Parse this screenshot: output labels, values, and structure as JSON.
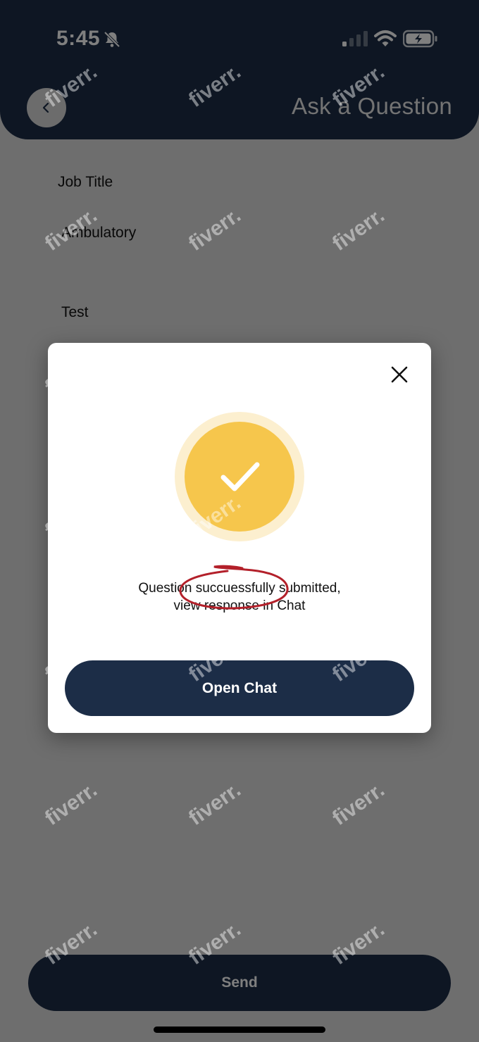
{
  "status_bar": {
    "time": "5:45",
    "icons": [
      "bell-slash-icon",
      "signal-icon",
      "wifi-icon",
      "battery-icon"
    ]
  },
  "header": {
    "title": "Ask a Question",
    "back_icon": "chevron-left-icon"
  },
  "form": {
    "job_title_label": "Job Title",
    "job_title_value": "Ambulatory",
    "message_value": "Test"
  },
  "modal": {
    "close_icon": "close-icon",
    "success_icon": "check-icon",
    "message_line1": "Question succuessfully submitted,",
    "message_line2": "view response in Chat",
    "open_chat_label": "Open Chat"
  },
  "send_label": "Send",
  "watermark_text": "fiverr.",
  "colors": {
    "navy": "#1c2d47",
    "success_yellow": "#f6c64c",
    "success_halo": "#fcefcf",
    "annotation_red": "#b3202a"
  }
}
